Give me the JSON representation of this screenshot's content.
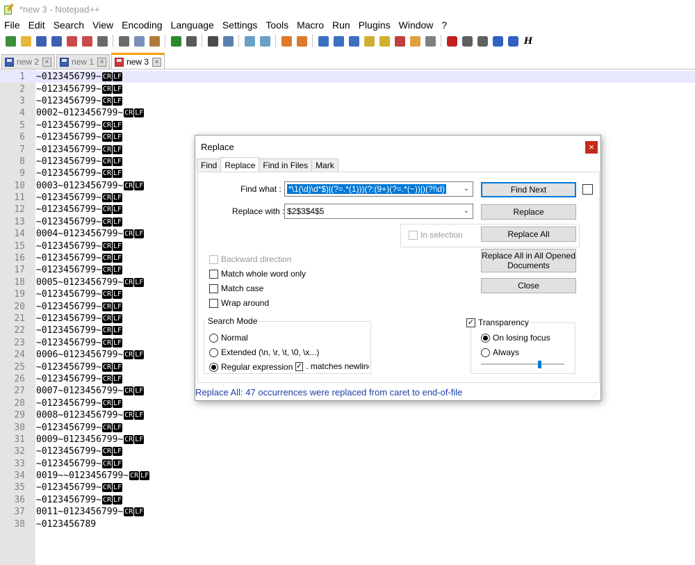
{
  "window": {
    "title": "*new 3 - Notepad++"
  },
  "menu": [
    "File",
    "Edit",
    "Search",
    "View",
    "Encoding",
    "Language",
    "Settings",
    "Tools",
    "Macro",
    "Run",
    "Plugins",
    "Window",
    "?"
  ],
  "toolbar": {
    "icons": [
      "new-file-icon",
      "open-file-icon",
      "save-icon",
      "save-all-icon",
      "close-icon",
      "close-all-icon",
      "print-icon",
      "cut-icon",
      "copy-icon",
      "paste-icon",
      "undo-icon",
      "redo-icon",
      "find-icon",
      "replace-icon",
      "zoom-in-icon",
      "zoom-out-icon",
      "sync-vertical-icon",
      "sync-horizontal-icon",
      "word-wrap-icon",
      "show-all-chars-icon",
      "indent-guide-icon",
      "user-lang-icon",
      "doc-map-icon",
      "function-list-icon",
      "folder-as-workspace-icon",
      "monitoring-icon",
      "record-macro-icon",
      "stop-macro-icon",
      "play-macro-icon",
      "run-macro-multiple-icon",
      "save-macro-icon",
      "hex-icon"
    ],
    "colors": [
      "#3a8f3a",
      "#e8b63a",
      "#3c5fb0",
      "#3c5fb0",
      "#c94a4a",
      "#c94a4a",
      "#6a6a6a",
      "#6a6a6a",
      "#7a8fb8",
      "#b07a3a",
      "#2a8a2a",
      "#5a5a5a",
      "#4a4a4a",
      "#5a7fb0",
      "#6aa0c8",
      "#6aa0c8",
      "#e07a2a",
      "#e07a2a",
      "#3c6fc0",
      "#3c6fc0",
      "#3c6fc0",
      "#d0b030",
      "#d0b030",
      "#c04040",
      "#e0a040",
      "#808080",
      "#c02020",
      "#606060",
      "#606060",
      "#3060c0",
      "#3060c0",
      "#303030"
    ],
    "hex_label": "H"
  },
  "tabs": [
    {
      "label": "new 2",
      "active": false
    },
    {
      "label": "new 1",
      "active": false
    },
    {
      "label": "new 3",
      "active": true
    }
  ],
  "editor": {
    "eol_cr": "CR",
    "eol_lf": "LF",
    "lines": [
      {
        "n": "1",
        "text": "~0123456799~",
        "eol": true
      },
      {
        "n": "2",
        "text": "~0123456799~",
        "eol": true
      },
      {
        "n": "3",
        "text": "~0123456799~",
        "eol": true
      },
      {
        "n": "4",
        "text": "0002~0123456799~",
        "eol": true
      },
      {
        "n": "5",
        "text": "~0123456799~",
        "eol": true
      },
      {
        "n": "6",
        "text": "~0123456799~",
        "eol": true
      },
      {
        "n": "7",
        "text": "~0123456799~",
        "eol": true
      },
      {
        "n": "8",
        "text": "~0123456799~",
        "eol": true
      },
      {
        "n": "9",
        "text": "~0123456799~",
        "eol": true
      },
      {
        "n": "10",
        "text": "0003~0123456799~",
        "eol": true
      },
      {
        "n": "11",
        "text": "~0123456799~",
        "eol": true
      },
      {
        "n": "12",
        "text": "~0123456799~",
        "eol": true
      },
      {
        "n": "13",
        "text": "~0123456799~",
        "eol": true
      },
      {
        "n": "14",
        "text": "0004~0123456799~",
        "eol": true
      },
      {
        "n": "15",
        "text": "~0123456799~",
        "eol": true
      },
      {
        "n": "16",
        "text": "~0123456799~",
        "eol": true
      },
      {
        "n": "17",
        "text": "~0123456799~",
        "eol": true
      },
      {
        "n": "18",
        "text": "0005~0123456799~",
        "eol": true
      },
      {
        "n": "19",
        "text": "~0123456799~",
        "eol": true
      },
      {
        "n": "20",
        "text": "~0123456799~",
        "eol": true
      },
      {
        "n": "21",
        "text": "~0123456799~",
        "eol": true
      },
      {
        "n": "22",
        "text": "~0123456799~",
        "eol": true
      },
      {
        "n": "23",
        "text": "~0123456799~",
        "eol": true
      },
      {
        "n": "24",
        "text": "0006~0123456799~",
        "eol": true
      },
      {
        "n": "25",
        "text": "~0123456799~",
        "eol": true
      },
      {
        "n": "26",
        "text": "~0123456799~",
        "eol": true
      },
      {
        "n": "27",
        "text": "0007~0123456799~",
        "eol": true
      },
      {
        "n": "28",
        "text": "~0123456799~",
        "eol": true
      },
      {
        "n": "29",
        "text": "0008~0123456799~",
        "eol": true
      },
      {
        "n": "30",
        "text": "~0123456799~",
        "eol": true
      },
      {
        "n": "31",
        "text": "0009~0123456799~",
        "eol": true
      },
      {
        "n": "32",
        "text": "~0123456799~",
        "eol": true
      },
      {
        "n": "33",
        "text": "~0123456799~",
        "eol": true
      },
      {
        "n": "34",
        "text": "0019~~0123456799~",
        "eol": true
      },
      {
        "n": "35",
        "text": "~0123456799~",
        "eol": true
      },
      {
        "n": "36",
        "text": "~0123456799~",
        "eol": true
      },
      {
        "n": "37",
        "text": "0011~0123456799~",
        "eol": true
      },
      {
        "n": "38",
        "text": "~0123456789",
        "eol": false
      }
    ]
  },
  "dialog": {
    "title": "Replace",
    "close": "×",
    "tabs": [
      "Find",
      "Replace",
      "Find in Files",
      "Mark"
    ],
    "find_what_label": "Find what :",
    "find_what_value": "*\\1(\\d)\\d*$)|(?=.*(1)))(?:(9+)(?=.*(~))|)(?!\\d)",
    "replace_with_label": "Replace with :",
    "replace_with_value": "$2$3$4$5",
    "buttons": {
      "find_next": "Find Next",
      "replace": "Replace",
      "replace_all": "Replace All",
      "replace_all_opened": "Replace All in All Opened Documents",
      "close": "Close"
    },
    "in_selection": "In selection",
    "backward_direction": "Backward direction",
    "match_whole_word": "Match whole word only",
    "match_case": "Match case",
    "wrap_around": "Wrap around",
    "search_mode": {
      "title": "Search Mode",
      "normal": "Normal",
      "extended": "Extended (\\n, \\r, \\t, \\0, \\x...)",
      "regex": "Regular expression",
      "matches_newline": ". matches newline",
      "selected": "regex"
    },
    "transparency": {
      "label": "Transparency",
      "checked": true,
      "on_losing_focus": "On losing focus",
      "always": "Always",
      "selected": "on_losing_focus",
      "level": 0.7
    },
    "status": "Replace All: 47 occurrences were replaced from caret to end-of-file",
    "status_color": "#1e3fa5"
  }
}
